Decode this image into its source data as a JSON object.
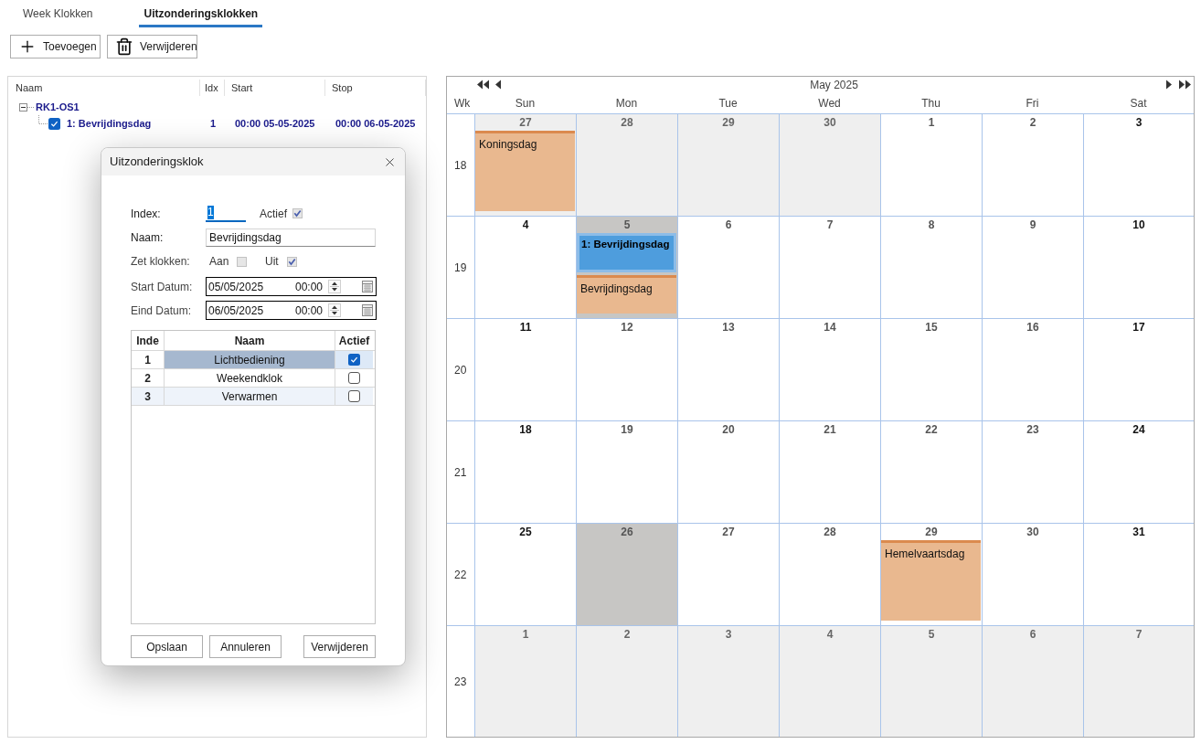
{
  "tabs": [
    {
      "label": "Week Klokken",
      "selected": false
    },
    {
      "label": "Uitzonderingsklokken",
      "selected": true
    }
  ],
  "toolbar": [
    {
      "label": "Toevoegen",
      "kind": "add"
    },
    {
      "label": "Verwijderen",
      "kind": "delete"
    }
  ],
  "tree": {
    "columns": [
      "Naam",
      "Idx",
      "Start",
      "Stop"
    ],
    "nodes": [
      {
        "label": "RK1-OS1",
        "expanded": true,
        "children": [
          {
            "label": "1: Bevrijdingsdag",
            "checked": true,
            "idx": "1",
            "start": "00:00 05-05-2025",
            "stop": "00:00 06-05-2025"
          }
        ]
      }
    ]
  },
  "dialog": {
    "title": "Uitzonderingsklok",
    "index": {
      "label": "Index:",
      "value": "1",
      "text_selected": true
    },
    "active": {
      "label": "Actief",
      "checked": true
    },
    "name": {
      "label": "Naam:",
      "value": "Bevrijdingsdag"
    },
    "set_clocks": {
      "label": "Zet klokken:",
      "options": [
        {
          "label": "Aan",
          "checked": false
        },
        {
          "label": "Uit",
          "checked": true
        }
      ]
    },
    "dates": [
      {
        "label": "Start Datum:",
        "date": "05/05/2025",
        "time": "00:00"
      },
      {
        "label": "Eind Datum:",
        "date": "06/05/2025",
        "time": "00:00"
      }
    ],
    "table": {
      "columns": [
        "Inde",
        "Naam",
        "Actief"
      ],
      "rows": [
        {
          "index": "1",
          "name": "Lichtbediening",
          "active": true,
          "selected": true
        },
        {
          "index": "2",
          "name": "Weekendklok",
          "active": false,
          "selected": false
        },
        {
          "index": "3",
          "name": "Verwarmen",
          "active": false,
          "selected": false
        }
      ]
    },
    "buttons": [
      "Opslaan",
      "Annuleren",
      "Verwijderen"
    ]
  },
  "calendar": {
    "title": "May 2025",
    "week_label": "Wk",
    "weekdays": [
      "Sun",
      "Mon",
      "Tue",
      "Wed",
      "Thu",
      "Fri",
      "Sat"
    ],
    "weeks": [
      {
        "week": "18",
        "days": [
          {
            "day": "27",
            "kind": "other_month",
            "highlighted": false,
            "events": [
              {
                "label": "Koningsdag",
                "kind": "holiday"
              }
            ]
          },
          {
            "day": "28",
            "kind": "other_month",
            "highlighted": false
          },
          {
            "day": "29",
            "kind": "other_month",
            "highlighted": false
          },
          {
            "day": "30",
            "kind": "other_month",
            "highlighted": false
          },
          {
            "day": "1",
            "kind": "weekday",
            "highlighted": false
          },
          {
            "day": "2",
            "kind": "weekday",
            "highlighted": false
          },
          {
            "day": "3",
            "kind": "weekend",
            "highlighted": false
          }
        ]
      },
      {
        "week": "19",
        "days": [
          {
            "day": "4",
            "kind": "weekend",
            "highlighted": false
          },
          {
            "day": "5",
            "kind": "weekday",
            "highlighted": true,
            "events": [
              {
                "label": "1: Bevrijdingsdag",
                "kind": "exception"
              },
              {
                "label": "Bevrijdingsdag",
                "kind": "holiday"
              }
            ]
          },
          {
            "day": "6",
            "kind": "weekday",
            "highlighted": false
          },
          {
            "day": "7",
            "kind": "weekday",
            "highlighted": false
          },
          {
            "day": "8",
            "kind": "weekday",
            "highlighted": false
          },
          {
            "day": "9",
            "kind": "weekday",
            "highlighted": false
          },
          {
            "day": "10",
            "kind": "weekend",
            "highlighted": false
          }
        ]
      },
      {
        "week": "20",
        "days": [
          {
            "day": "11",
            "kind": "weekend",
            "highlighted": false
          },
          {
            "day": "12",
            "kind": "weekday",
            "highlighted": false
          },
          {
            "day": "13",
            "kind": "weekday",
            "highlighted": false
          },
          {
            "day": "14",
            "kind": "weekday",
            "highlighted": false
          },
          {
            "day": "15",
            "kind": "weekday",
            "highlighted": false
          },
          {
            "day": "16",
            "kind": "weekday",
            "highlighted": false
          },
          {
            "day": "17",
            "kind": "weekend",
            "highlighted": false
          }
        ]
      },
      {
        "week": "21",
        "days": [
          {
            "day": "18",
            "kind": "weekend",
            "highlighted": false
          },
          {
            "day": "19",
            "kind": "weekday",
            "highlighted": false
          },
          {
            "day": "20",
            "kind": "weekday",
            "highlighted": false
          },
          {
            "day": "21",
            "kind": "weekday",
            "highlighted": false
          },
          {
            "day": "22",
            "kind": "weekday",
            "highlighted": false
          },
          {
            "day": "23",
            "kind": "weekday",
            "highlighted": false
          },
          {
            "day": "24",
            "kind": "weekend",
            "highlighted": false
          }
        ]
      },
      {
        "week": "22",
        "days": [
          {
            "day": "25",
            "kind": "weekend",
            "highlighted": false
          },
          {
            "day": "26",
            "kind": "weekday",
            "highlighted": true
          },
          {
            "day": "27",
            "kind": "weekday",
            "highlighted": false
          },
          {
            "day": "28",
            "kind": "weekday",
            "highlighted": false
          },
          {
            "day": "29",
            "kind": "weekday",
            "highlighted": false,
            "events": [
              {
                "label": "Hemelvaartsdag",
                "kind": "holiday"
              }
            ]
          },
          {
            "day": "30",
            "kind": "weekday",
            "highlighted": false
          },
          {
            "day": "31",
            "kind": "weekend",
            "highlighted": false
          }
        ]
      },
      {
        "week": "23",
        "days": [
          {
            "day": "1",
            "kind": "other_month",
            "highlighted": false
          },
          {
            "day": "2",
            "kind": "other_month",
            "highlighted": false
          },
          {
            "day": "3",
            "kind": "other_month",
            "highlighted": false
          },
          {
            "day": "4",
            "kind": "other_month",
            "highlighted": false
          },
          {
            "day": "5",
            "kind": "other_month",
            "highlighted": false
          },
          {
            "day": "6",
            "kind": "other_month",
            "highlighted": false
          },
          {
            "day": "7",
            "kind": "other_month",
            "highlighted": false
          }
        ]
      }
    ]
  }
}
